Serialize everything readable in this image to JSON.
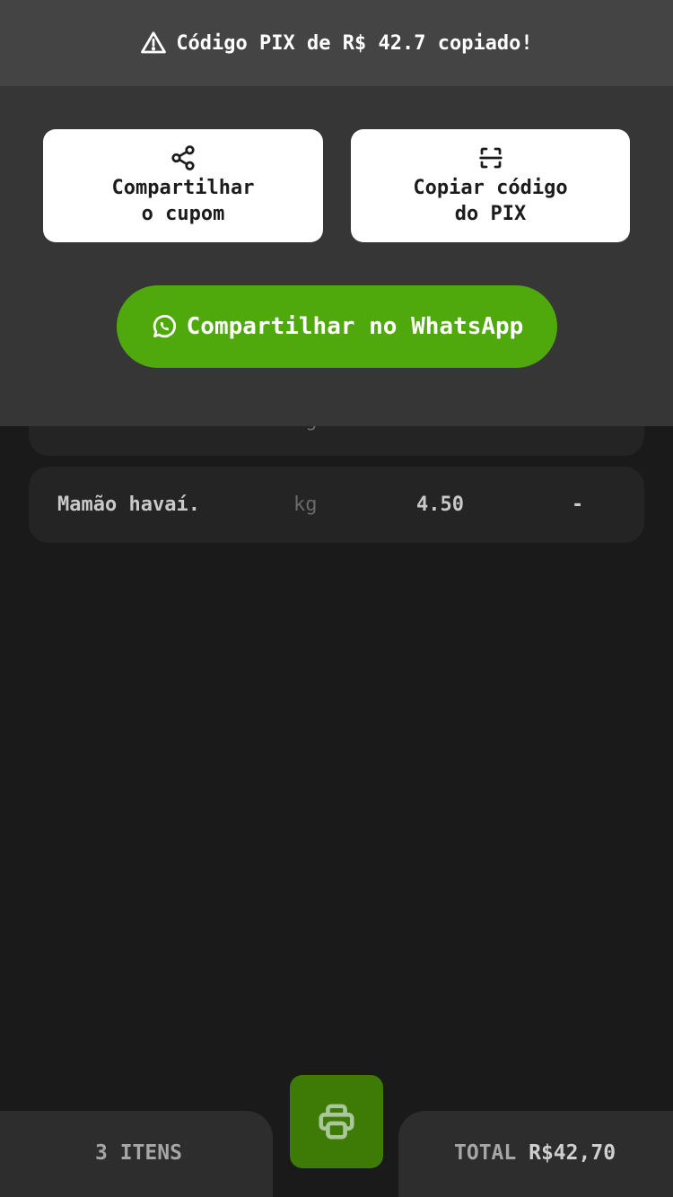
{
  "toast": {
    "message": "Código PIX de R$ 42.7 copiado!",
    "icon": "warning-icon"
  },
  "actions": {
    "share_coupon": {
      "line1": "Compartilhar",
      "line2": "o cupom",
      "icon": "share-icon"
    },
    "copy_pix": {
      "line1": "Copiar código",
      "line2": "do PIX",
      "icon": "scan-icon"
    },
    "whatsapp": {
      "label": "Compartilhar no WhatsApp",
      "icon": "whatsapp-icon",
      "color": "#4fa90d"
    }
  },
  "items": [
    {
      "name": "",
      "unit": "kg",
      "qty": "",
      "price": ""
    },
    {
      "name": "Mamão havaí.",
      "unit": "kg",
      "qty": "4.50",
      "price": "-"
    }
  ],
  "footer": {
    "count": "3 ITENS",
    "total_label": "TOTAL",
    "total_value": "R$42,70",
    "print_icon": "printer-icon",
    "accent": "#3d7a06"
  }
}
